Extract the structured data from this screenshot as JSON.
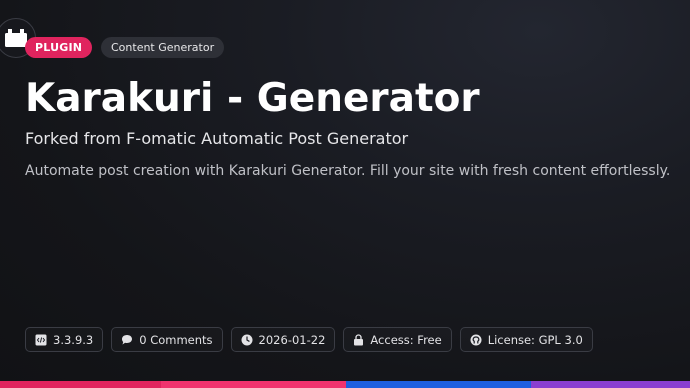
{
  "header": {
    "icon": "plugin-box-icon",
    "type_badge": "PLUGIN",
    "category_badge": "Content Generator"
  },
  "hero": {
    "title": "Karakuri - Generator",
    "subtitle": "Forked from F-omatic Automatic Post Generator",
    "description": "Automate post creation with Karakuri Generator. Fill your site with fresh content effortlessly."
  },
  "meta": [
    {
      "icon": "code-file-icon",
      "label": "3.3.9.3"
    },
    {
      "icon": "comment-bubble-icon",
      "label": "0 Comments"
    },
    {
      "icon": "clock-icon",
      "label": "2026-01-22"
    },
    {
      "icon": "lock-icon",
      "label": "Access: Free"
    },
    {
      "icon": "license-icon",
      "label": "License: GPL 3.0"
    }
  ],
  "colors": {
    "badge_accent": "#e0245e",
    "bottom_bar": [
      "#e0245e",
      "#f0336e",
      "#1d5fe0",
      "#8a3fd1"
    ]
  }
}
